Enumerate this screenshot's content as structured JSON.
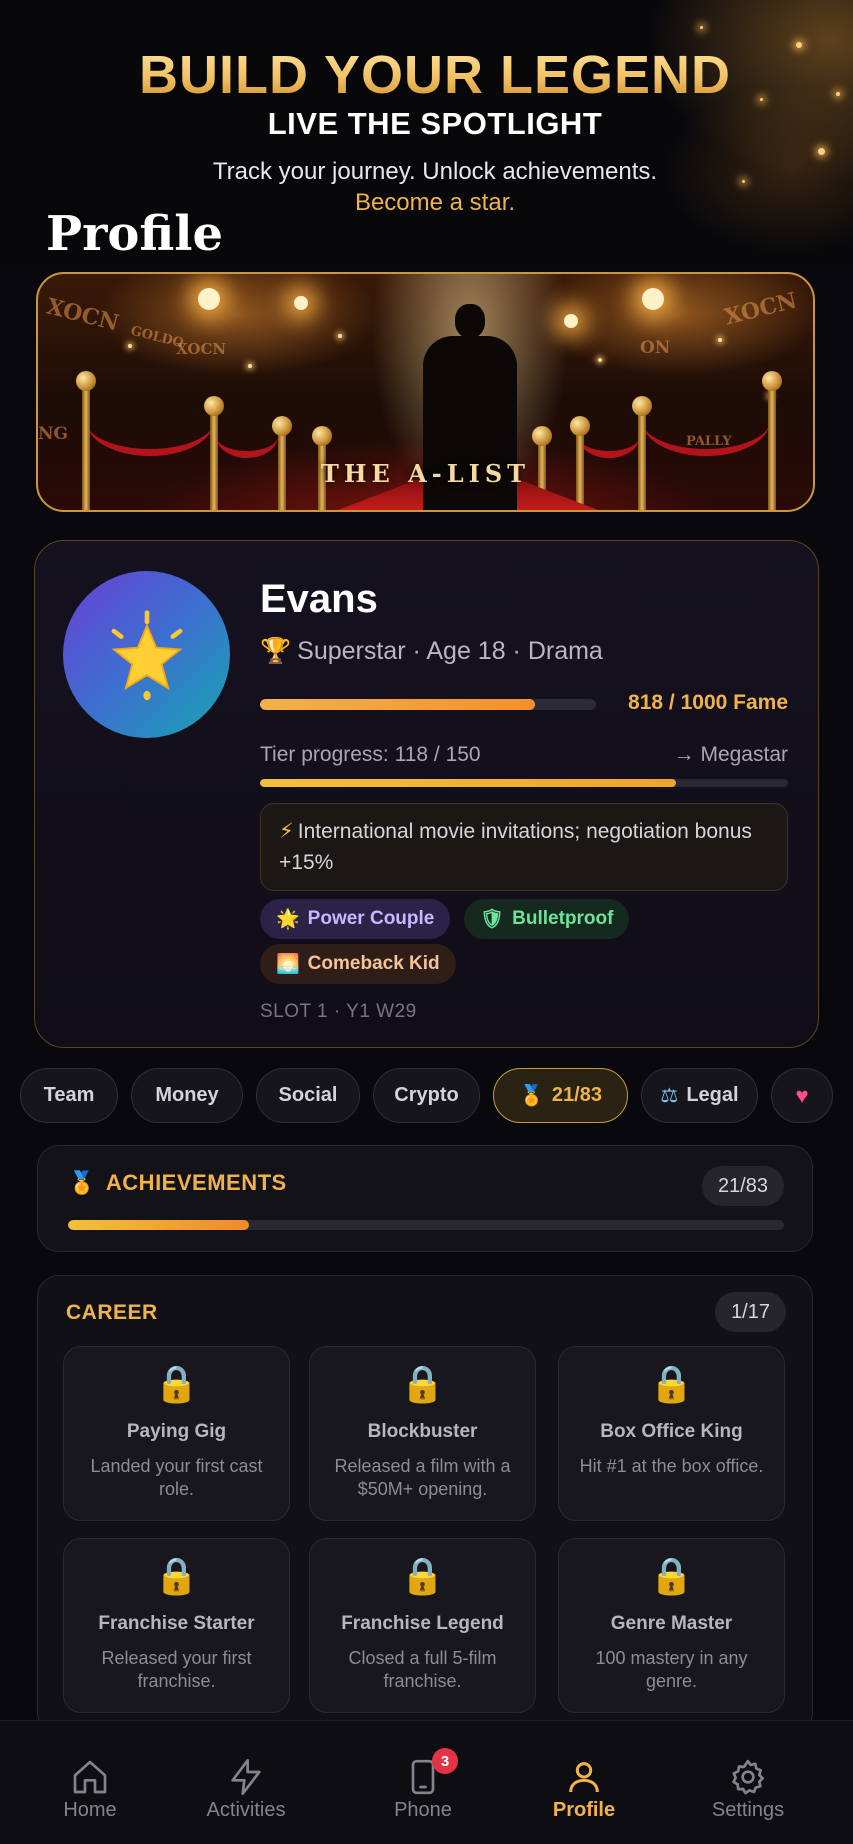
{
  "hero": {
    "title": "BUILD YOUR LEGEND",
    "subtitle": "LIVE THE SPOTLIGHT",
    "tagline_1": "Track your journey. Unlock achievements.",
    "tagline_2": "Become a star."
  },
  "page": {
    "title": "Profile"
  },
  "banner": {
    "text": "THE A-LIST",
    "background_words": [
      "XOCN",
      "GOLDO",
      "XOCN",
      "ON",
      "XOCN",
      "NG",
      "PALLY"
    ]
  },
  "profile": {
    "avatar_icon": "star-icon",
    "name": "Evans",
    "meta": "Superstar · Age 18 · Drama",
    "fame_text": "818 / 1000 Fame",
    "fame_fraction": 0.818,
    "tier_label": "Tier progress: 118 / 150",
    "tier_next": "→ Megastar",
    "tier_fraction": 0.787,
    "perk": "International movie invitations; negotiation bonus +15%",
    "traits": [
      {
        "label": "Power Couple",
        "icon": "star-icon"
      },
      {
        "label": "Bulletproof",
        "icon": "shield-icon"
      },
      {
        "label": "Comeback Kid",
        "icon": "sunrise-icon"
      }
    ],
    "slot": "SLOT 1 · Y1 W29"
  },
  "tabs": [
    {
      "label": "Team"
    },
    {
      "label": "Money"
    },
    {
      "label": "Social"
    },
    {
      "label": "Crypto"
    },
    {
      "label": "21/83",
      "icon": "medal-icon",
      "active": true
    },
    {
      "label": "Legal",
      "icon": "scales-icon"
    },
    {
      "label": "",
      "icon": "heart-icon"
    }
  ],
  "achievements": {
    "title": "ACHIEVEMENTS",
    "count": "21/83",
    "fraction": 0.253
  },
  "career": {
    "title": "CAREER",
    "count": "1/17",
    "items": [
      {
        "name": "Paying Gig",
        "desc": "Landed your first cast role."
      },
      {
        "name": "Blockbuster",
        "desc": "Released a film with a $50M+ opening."
      },
      {
        "name": "Box Office King",
        "desc": "Hit #1 at the box office."
      },
      {
        "name": "Franchise Starter",
        "desc": "Released your first franchise."
      },
      {
        "name": "Franchise Legend",
        "desc": "Closed a full 5-film franchise."
      },
      {
        "name": "Genre Master",
        "desc": "100 mastery in any genre."
      }
    ]
  },
  "nav": {
    "items": [
      {
        "label": "Home",
        "icon": "home-icon"
      },
      {
        "label": "Activities",
        "icon": "bolt-icon"
      },
      {
        "label": "Phone",
        "icon": "phone-icon",
        "badge": "3"
      },
      {
        "label": "Profile",
        "icon": "person-icon",
        "active": true
      },
      {
        "label": "Settings",
        "icon": "gear-icon"
      }
    ]
  },
  "colors": {
    "accent": "#f1b24a",
    "background": "#09090d",
    "badge": "#e23445"
  }
}
